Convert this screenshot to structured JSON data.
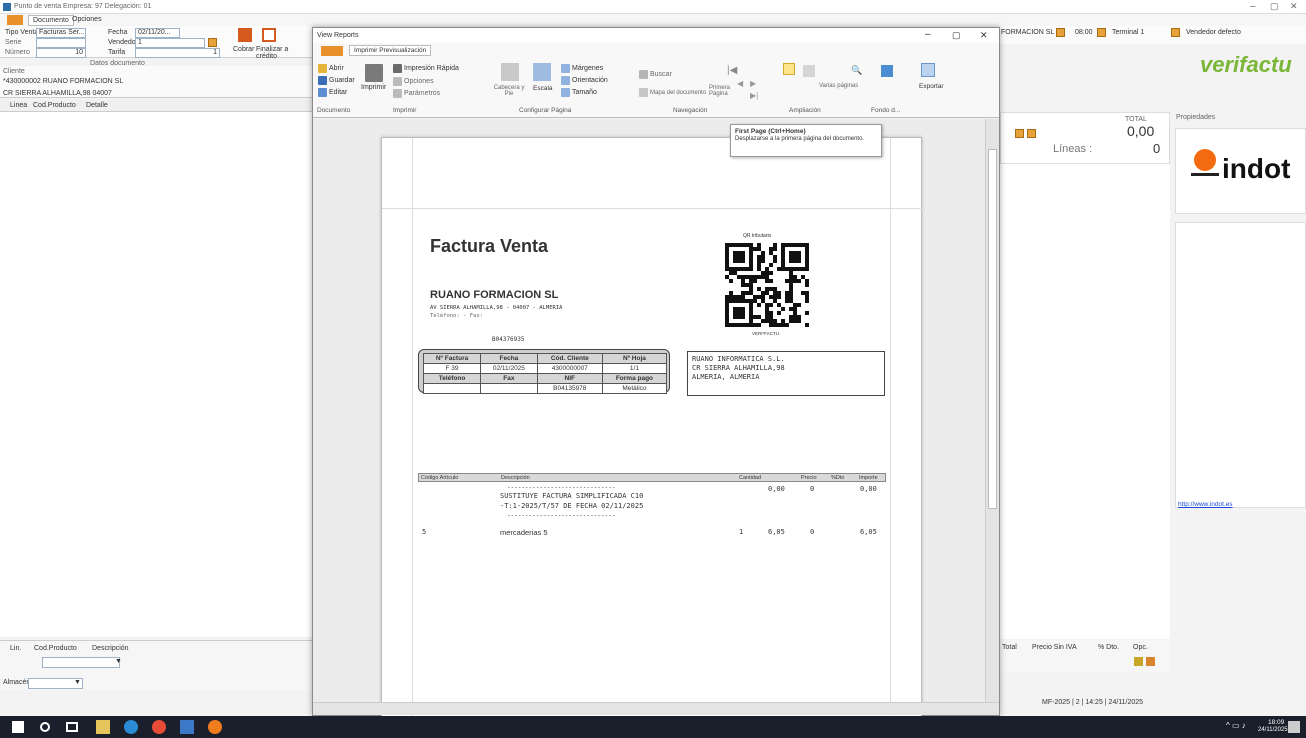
{
  "app": {
    "title": "Punto de venta Empresa: 97 Delegación: 01",
    "tabs": [
      "Documento",
      "Opciones"
    ],
    "fields": {
      "tipo_venta_label": "Tipo Venta",
      "tipo_venta_value": "Facturas Ser...",
      "fecha_label": "Fecha",
      "fecha_value": "02/11/20...",
      "serie_label": "Serie",
      "vendedor_label": "Vendedor",
      "vendedor_value": "1",
      "numero_label": "Número",
      "numero_value": "10",
      "tarifa_label": "Tarifa",
      "tarifa_value": "1"
    },
    "cobrar_label": "Cobrar",
    "finalizar_label": "Finalizar a crédito",
    "datos_label": "Datos documento",
    "cliente_label": "Cliente",
    "cliente_value": "*430000002 RUANO FORMACION SL",
    "direccion_value": "CR SIERRA ALHAMILLA,98 04007",
    "grid_cols": [
      "Linea",
      "Cod.Producto",
      "Detalle"
    ],
    "bottom_cols": [
      "Lin.",
      "Cod.Producto",
      "Descripción"
    ],
    "almacen_label": "Almacén",
    "right": {
      "status_items": [
        "FORMACION SL",
        "08:00",
        "Terminal 1",
        "Vendedor defecto"
      ],
      "total_label": "TOTAL",
      "total_value": "0,00",
      "lineas_label": "Líneas :",
      "lineas_value": "0",
      "right_cols": [
        "Total",
        "Precio Sin IVA",
        "% Dto.",
        "Opc."
      ],
      "status_bar": "MF-2025 | 2 | 14:25 | 24/11/2025"
    },
    "propiedades_label": "Propiedades",
    "verifactu_logo": "verifactu",
    "indot_logo": "indot",
    "link": "http://www.indot.es"
  },
  "viewer": {
    "title": "View Reports",
    "ribbon_tab": "Imprimir Previsualización",
    "buttons": {
      "abrir": "Abrir",
      "guardar": "Guardar",
      "editar": "Editar",
      "imprimir": "Imprimir",
      "rapida": "Impresión Rápida",
      "opciones": "Opciones",
      "parametros": "Parámetros",
      "cabecera": "Cabecera y Pie",
      "escala": "Escala",
      "margenes": "Márgenes",
      "orientacion": "Orientación",
      "tamano": "Tamaño",
      "buscar": "Buscar",
      "mapa": "Mapa del documento",
      "primera": "Primera Página",
      "varias": "Varias páginas",
      "exportar": "Exportar"
    },
    "groups": [
      "Documento",
      "Imprimir",
      "Configurar Página",
      "Navegación",
      "Ampliación",
      "Fondo d...",
      "Exportar"
    ],
    "tooltip": {
      "title": "First Page (Ctrl+Home)",
      "body": "Desplazarse a la primera página del documento."
    }
  },
  "invoice": {
    "title": "Factura Venta",
    "company": "RUANO FORMACION SL",
    "address": "AV SIERRA ALHAMILLA,98 - 04007 - ALMERIA",
    "phone": "Teléfono: - Fax:",
    "nif": "B04376935",
    "qr_label": "QR tributario",
    "qr_caption": "VERI*FACTU",
    "info_headers": [
      "Nº Factura",
      "Fecha",
      "Cód. Cliente",
      "Nº Hoja"
    ],
    "info_values": [
      "F 39",
      "02/11/2025",
      "4300000007",
      "1/1"
    ],
    "info_headers2": [
      "Teléfono",
      "Fax",
      "NIF",
      "Forma pago"
    ],
    "info_values2": [
      "",
      "",
      "B04135978",
      "Metálico"
    ],
    "client": [
      "RUANO INFORMATICA S.L.",
      "CR SIERRA ALHAMILLA,98",
      "ALMERIA, ALMERIA"
    ],
    "cols": [
      "Código Artículo",
      "Descripción",
      "Cantidad",
      "Precio",
      "%Dto",
      "Importe"
    ],
    "row1": {
      "desc1": "SUSTITUYE FACTURA SIMPLIFICADA C10",
      "desc2": "-T:1-2025/T/57 DE FECHA 02/11/2025",
      "precio": "0,00",
      "dto": "0",
      "importe": "0,00"
    },
    "row2": {
      "cod": "5",
      "desc": "mercaderias 5",
      "cant": "1",
      "precio": "6,05",
      "dto": "0",
      "importe": "6,05"
    }
  },
  "taskbar": {
    "clock": "18:09",
    "date": "24/11/2025"
  }
}
